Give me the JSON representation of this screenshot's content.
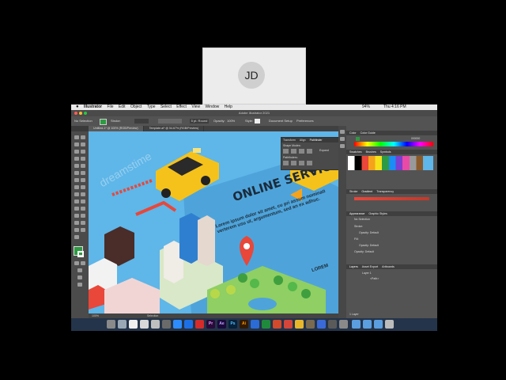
{
  "presenter": {
    "initials": "JD"
  },
  "menubar": {
    "app": "Illustrator",
    "items": [
      "File",
      "Edit",
      "Object",
      "Type",
      "Select",
      "Effect",
      "View",
      "Window",
      "Help"
    ],
    "battery": "94%",
    "clock": "Thu 4:16 PM"
  },
  "window": {
    "title": "Adobe Illustrator 2021"
  },
  "control_bar": {
    "selection": "No Selection",
    "stroke_label": "Stroke:",
    "brush": "5 pt. Round",
    "opacity_label": "Opacity:",
    "opacity": "100%",
    "style_label": "Style:",
    "document_setup": "Document Setup",
    "preferences": "Preferences"
  },
  "tabs": [
    {
      "label": "Untitled-1* @ 100% (RGB/Preview)"
    },
    {
      "label": "Template.ai* @ 54.67% (RGB/Preview)"
    }
  ],
  "canvas": {
    "headline": "ONLINE SERVICE",
    "body": "Lorem ipsum dolor sit amet, cu pri assum nominati verterem usu ut, argumentum, sed an ex adhuc.",
    "badge": "LOREM",
    "watermark": "dreamstime"
  },
  "status": {
    "zoom": "100%",
    "tool": "Selection"
  },
  "float_panel": {
    "tabs": [
      "Transform",
      "Align",
      "Pathfinder"
    ],
    "shape_modes": "Shape Modes:",
    "pathfinders": "Pathfinders:",
    "expand": "Expand"
  },
  "right_panel": {
    "color_tabs": [
      "Color",
      "Color Guide"
    ],
    "swatch_tabs": [
      "Swatches",
      "Brushes",
      "Symbols"
    ],
    "stroke_tabs": [
      "Stroke",
      "Gradient",
      "Transparency"
    ],
    "appearance_tabs": [
      "Appearance",
      "Graphic Styles"
    ],
    "appearance_rows": [
      "No Selection",
      "Stroke:",
      "Opacity: Default",
      "Fill:",
      "Opacity: Default",
      "Opacity: Default"
    ],
    "layers_tabs": [
      "Layers",
      "Asset Export",
      "Artboards"
    ],
    "layers": [
      "Layer 1",
      "<Path>"
    ],
    "layers_count": "1 Layer"
  },
  "hex_value": "000000",
  "dock_apps": [
    "Pr",
    "Ae",
    "Ps",
    "Ai"
  ],
  "colors": {
    "canvas": "#5fb6e8",
    "taxi": "#f5c21b",
    "accent_red": "#e8473a",
    "ui_dark": "#535353"
  }
}
